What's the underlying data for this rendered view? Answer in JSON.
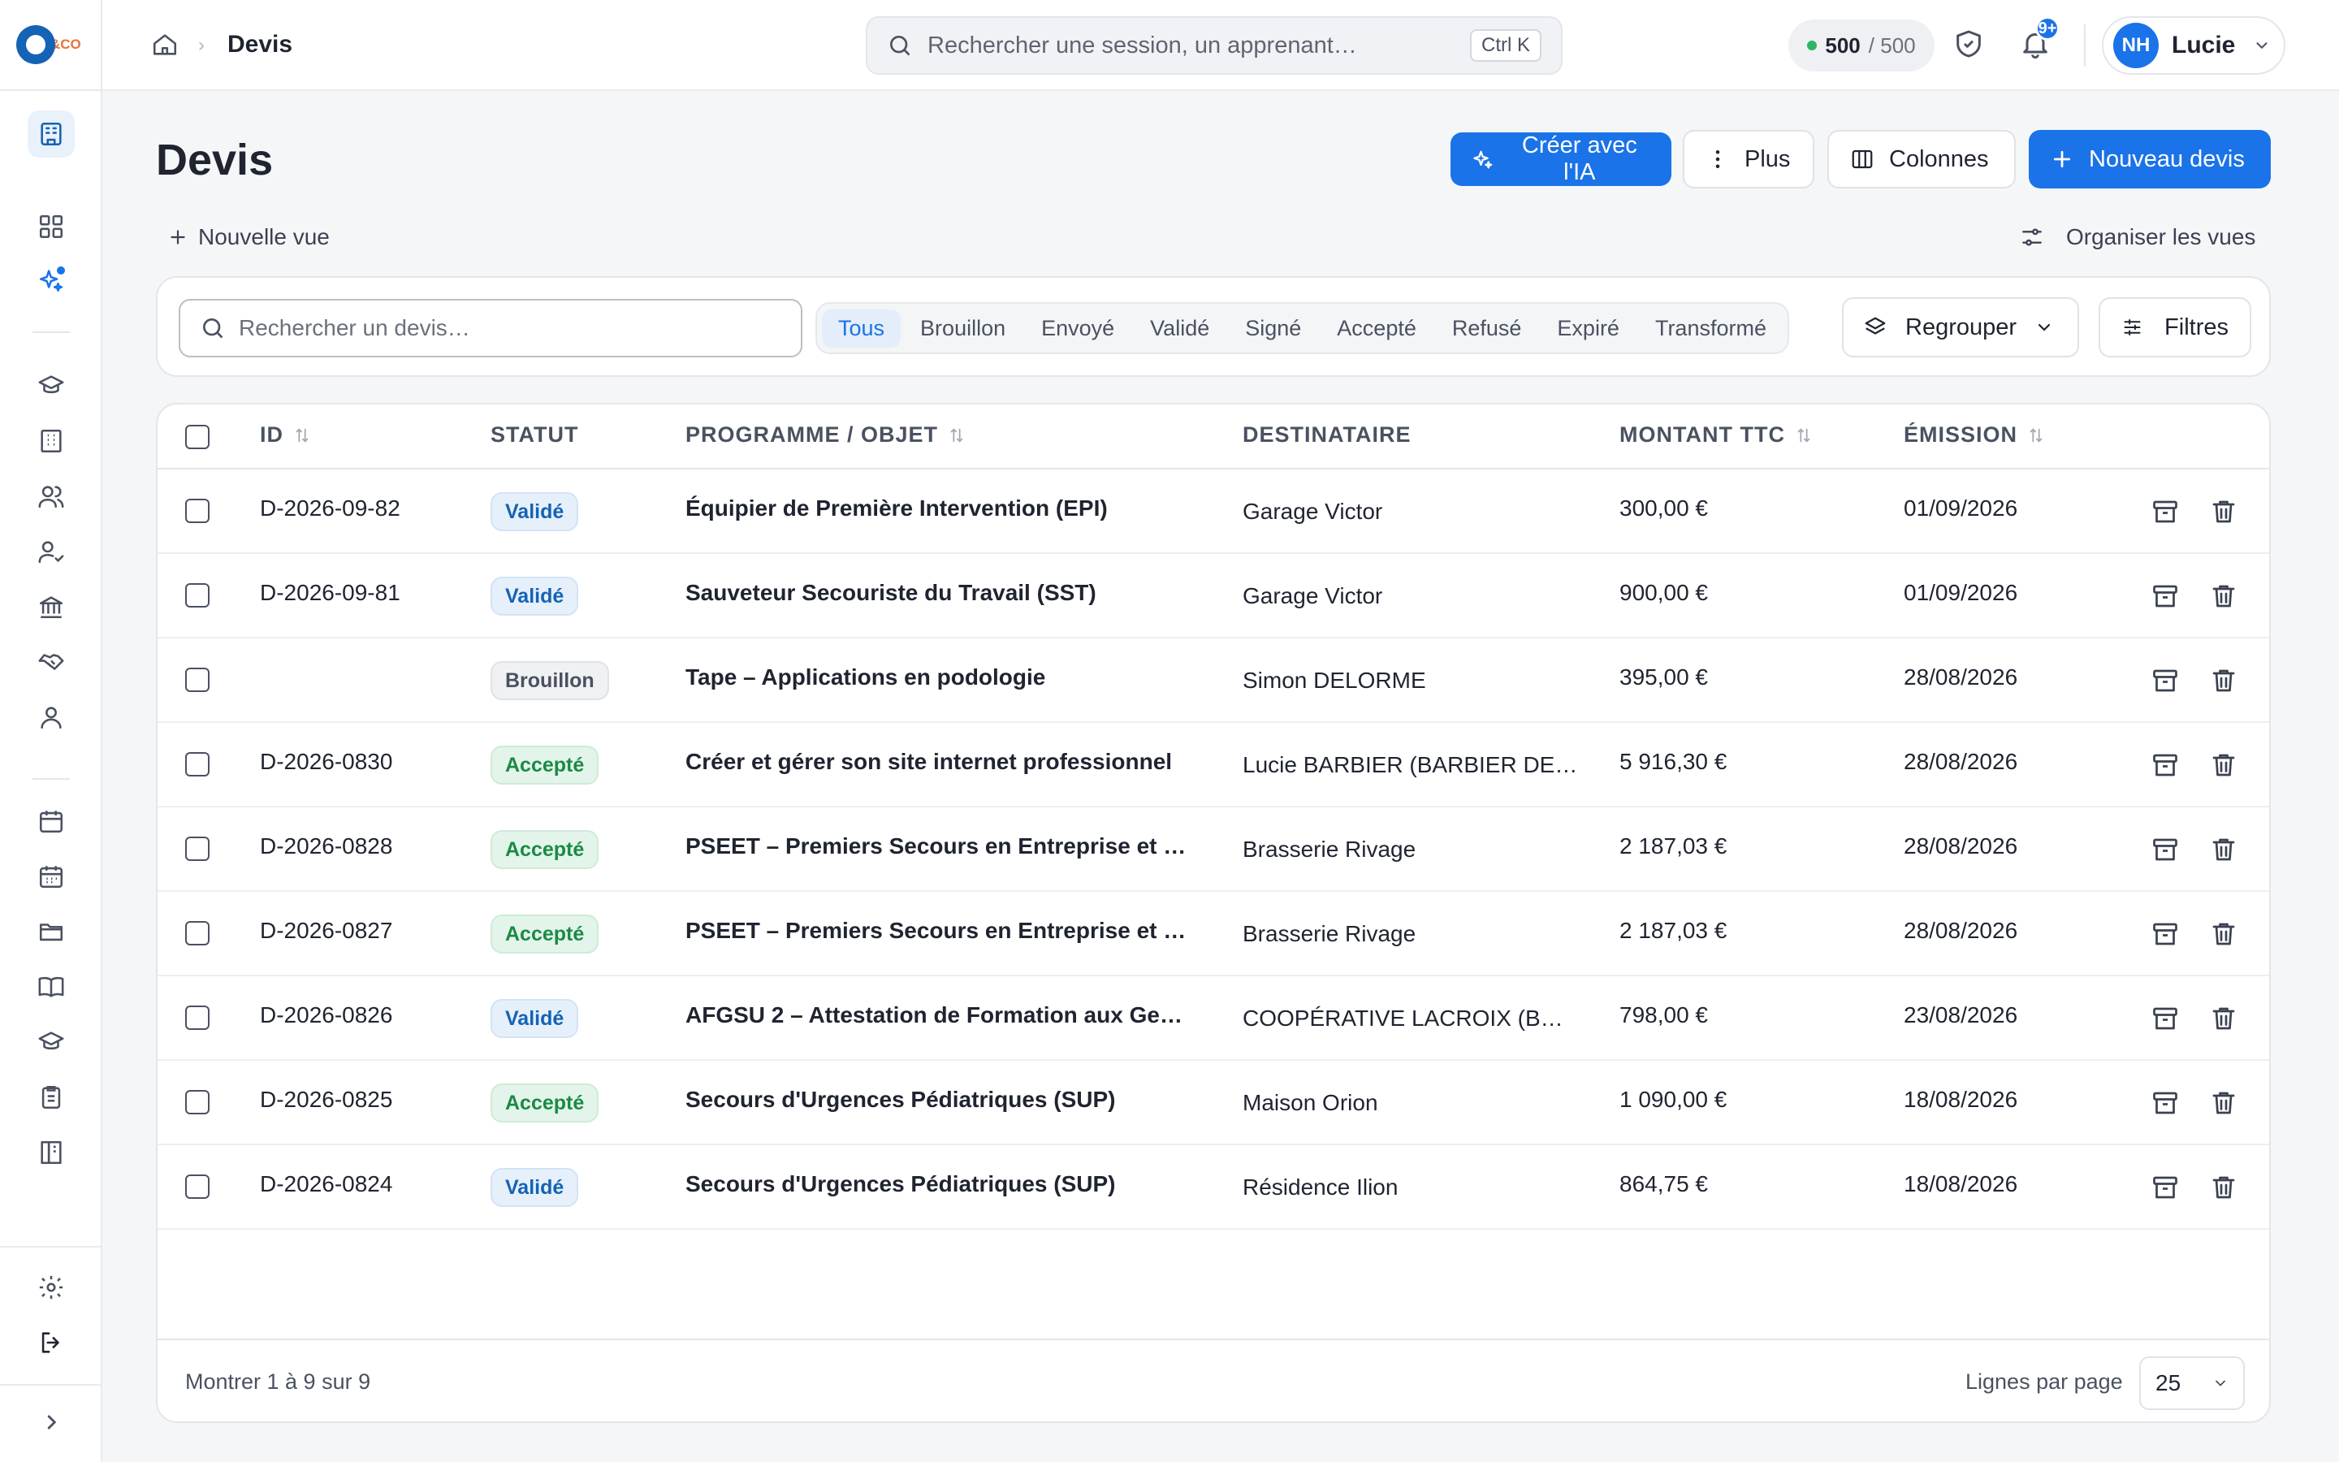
{
  "app": {
    "logo_text": "&CO"
  },
  "sidebar": {
    "items": [
      {
        "icon": "dashboard-building-icon",
        "active": true
      },
      {
        "icon": "grid-icon"
      },
      {
        "icon": "sparkles-icon",
        "dot": true
      },
      {
        "icon": "graduation-cap-icon"
      },
      {
        "icon": "building-icon"
      },
      {
        "icon": "users-icon"
      },
      {
        "icon": "user-check-icon"
      },
      {
        "icon": "bank-icon"
      },
      {
        "icon": "handshake-icon"
      },
      {
        "icon": "contacts-icon"
      },
      {
        "icon": "calendar-icon"
      },
      {
        "icon": "calendar-grid-icon"
      },
      {
        "icon": "folder-icon"
      },
      {
        "icon": "book-icon"
      },
      {
        "icon": "graduation-cap-2-icon"
      },
      {
        "icon": "clipboard-icon"
      },
      {
        "icon": "library-icon"
      },
      {
        "icon": "settings-icon"
      },
      {
        "icon": "logout-icon"
      },
      {
        "icon": "expand-chevron-icon"
      }
    ]
  },
  "topbar": {
    "breadcrumb_current": "Devis",
    "search_placeholder": "Rechercher une session, un apprenant…",
    "search_shortcut": "Ctrl K",
    "credits_used": "500",
    "credits_total": "/ 500",
    "notification_badge": "9+",
    "user_initials": "NH",
    "user_name": "Lucie"
  },
  "header": {
    "title": "Devis",
    "ai_button": "Créer avec l'IA",
    "more_button": "Plus",
    "columns_button": "Colonnes",
    "new_button": "Nouveau devis",
    "new_view": "Nouvelle vue",
    "organize_views": "Organiser les vues"
  },
  "filters": {
    "search_placeholder": "Rechercher un devis…",
    "status_tabs": [
      "Tous",
      "Brouillon",
      "Envoyé",
      "Validé",
      "Signé",
      "Accepté",
      "Refusé",
      "Expiré",
      "Transformé"
    ],
    "active_tab": "Tous",
    "group_button": "Regrouper",
    "filter_button": "Filtres"
  },
  "table": {
    "columns": {
      "id": "ID",
      "status": "STATUT",
      "program": "PROGRAMME / OBJET",
      "recipient": "DESTINATAIRE",
      "amount": "MONTANT TTC",
      "emission": "ÉMISSION"
    },
    "rows": [
      {
        "id": "D-2026-09-82",
        "status": "Validé",
        "status_kind": "valide",
        "program": "Équipier de Première Intervention (EPI)",
        "recipient": "Garage Victor",
        "amount": "300,00 €",
        "date": "01/09/2026"
      },
      {
        "id": "D-2026-09-81",
        "status": "Validé",
        "status_kind": "valide",
        "program": "Sauveteur Secouriste du Travail (SST)",
        "recipient": "Garage Victor",
        "amount": "900,00 €",
        "date": "01/09/2026"
      },
      {
        "id": "",
        "status": "Brouillon",
        "status_kind": "brouillon",
        "program": "Tape – Applications en podologie",
        "recipient": "Simon DELORME",
        "amount": "395,00 €",
        "date": "28/08/2026"
      },
      {
        "id": "D-2026-0830",
        "status": "Accepté",
        "status_kind": "accepte",
        "program": "Créer et gérer son site internet professionnel",
        "recipient": "Lucie BARBIER (BARBIER DE…",
        "amount": "5 916,30 €",
        "date": "28/08/2026"
      },
      {
        "id": "D-2026-0828",
        "status": "Accepté",
        "status_kind": "accepte",
        "program": "PSEET – Premiers Secours en Entreprise et …",
        "recipient": "Brasserie Rivage",
        "amount": "2 187,03 €",
        "date": "28/08/2026"
      },
      {
        "id": "D-2026-0827",
        "status": "Accepté",
        "status_kind": "accepte",
        "program": "PSEET – Premiers Secours en Entreprise et …",
        "recipient": "Brasserie Rivage",
        "amount": "2 187,03 €",
        "date": "28/08/2026"
      },
      {
        "id": "D-2026-0826",
        "status": "Validé",
        "status_kind": "valide",
        "program": "AFGSU 2 – Attestation de Formation aux Ge…",
        "recipient": "COOPÉRATIVE LACROIX (B…",
        "amount": "798,00 €",
        "date": "23/08/2026"
      },
      {
        "id": "D-2026-0825",
        "status": "Accepté",
        "status_kind": "accepte",
        "program": "Secours d'Urgences Pédiatriques (SUP)",
        "recipient": "Maison Orion",
        "amount": "1 090,00 €",
        "date": "18/08/2026"
      },
      {
        "id": "D-2026-0824",
        "status": "Validé",
        "status_kind": "valide",
        "program": "Secours d'Urgences Pédiatriques (SUP)",
        "recipient": "Résidence Ilion",
        "amount": "864,75 €",
        "date": "18/08/2026"
      }
    ],
    "footer_showing": "Montrer 1 à 9 sur 9",
    "rows_per_page_label": "Lignes par page",
    "rows_per_page_value": "25"
  },
  "colors": {
    "accent": "#1a73e8",
    "valide": "#1463b5",
    "accepte": "#1b8a45",
    "brouillon": "#4a5160"
  }
}
